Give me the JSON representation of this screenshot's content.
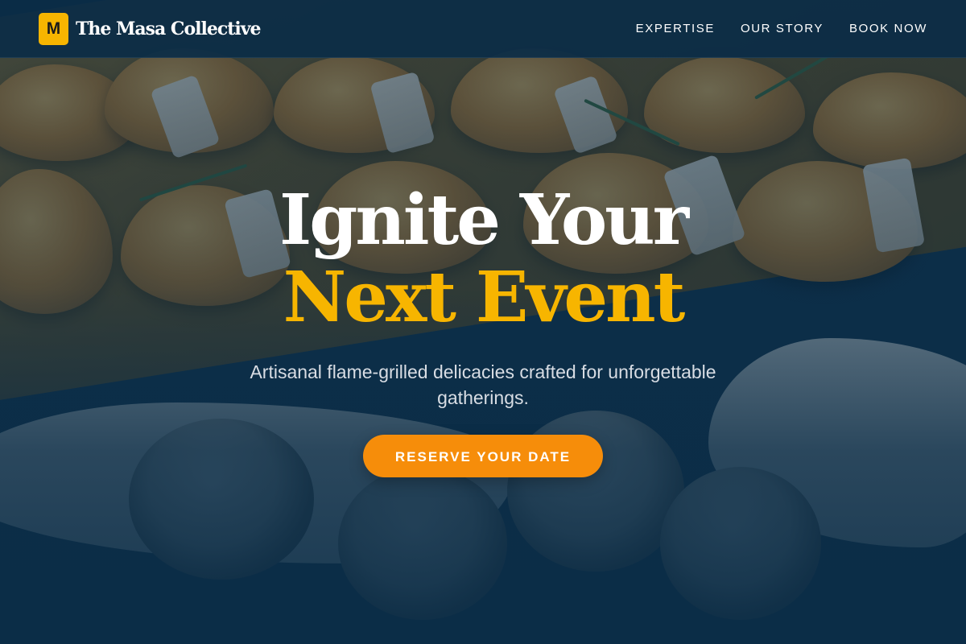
{
  "header": {
    "logo_letter": "M",
    "brand_name": "The Masa Collective",
    "nav": [
      {
        "label": "EXPERTISE"
      },
      {
        "label": "OUR STORY"
      },
      {
        "label": "BOOK NOW"
      }
    ]
  },
  "hero": {
    "headline_line1": "Ignite Your",
    "headline_line2": "Next Event",
    "subtitle": "Artisanal flame-grilled delicacies crafted for unforgettable gatherings.",
    "cta_label": "RESERVE YOUR DATE",
    "background_image": "catering-pastries-photo"
  },
  "colors": {
    "navy": "#0b2d47",
    "gold": "#f7b500",
    "orange_cta": "#f68d0a",
    "white": "#ffffff"
  }
}
